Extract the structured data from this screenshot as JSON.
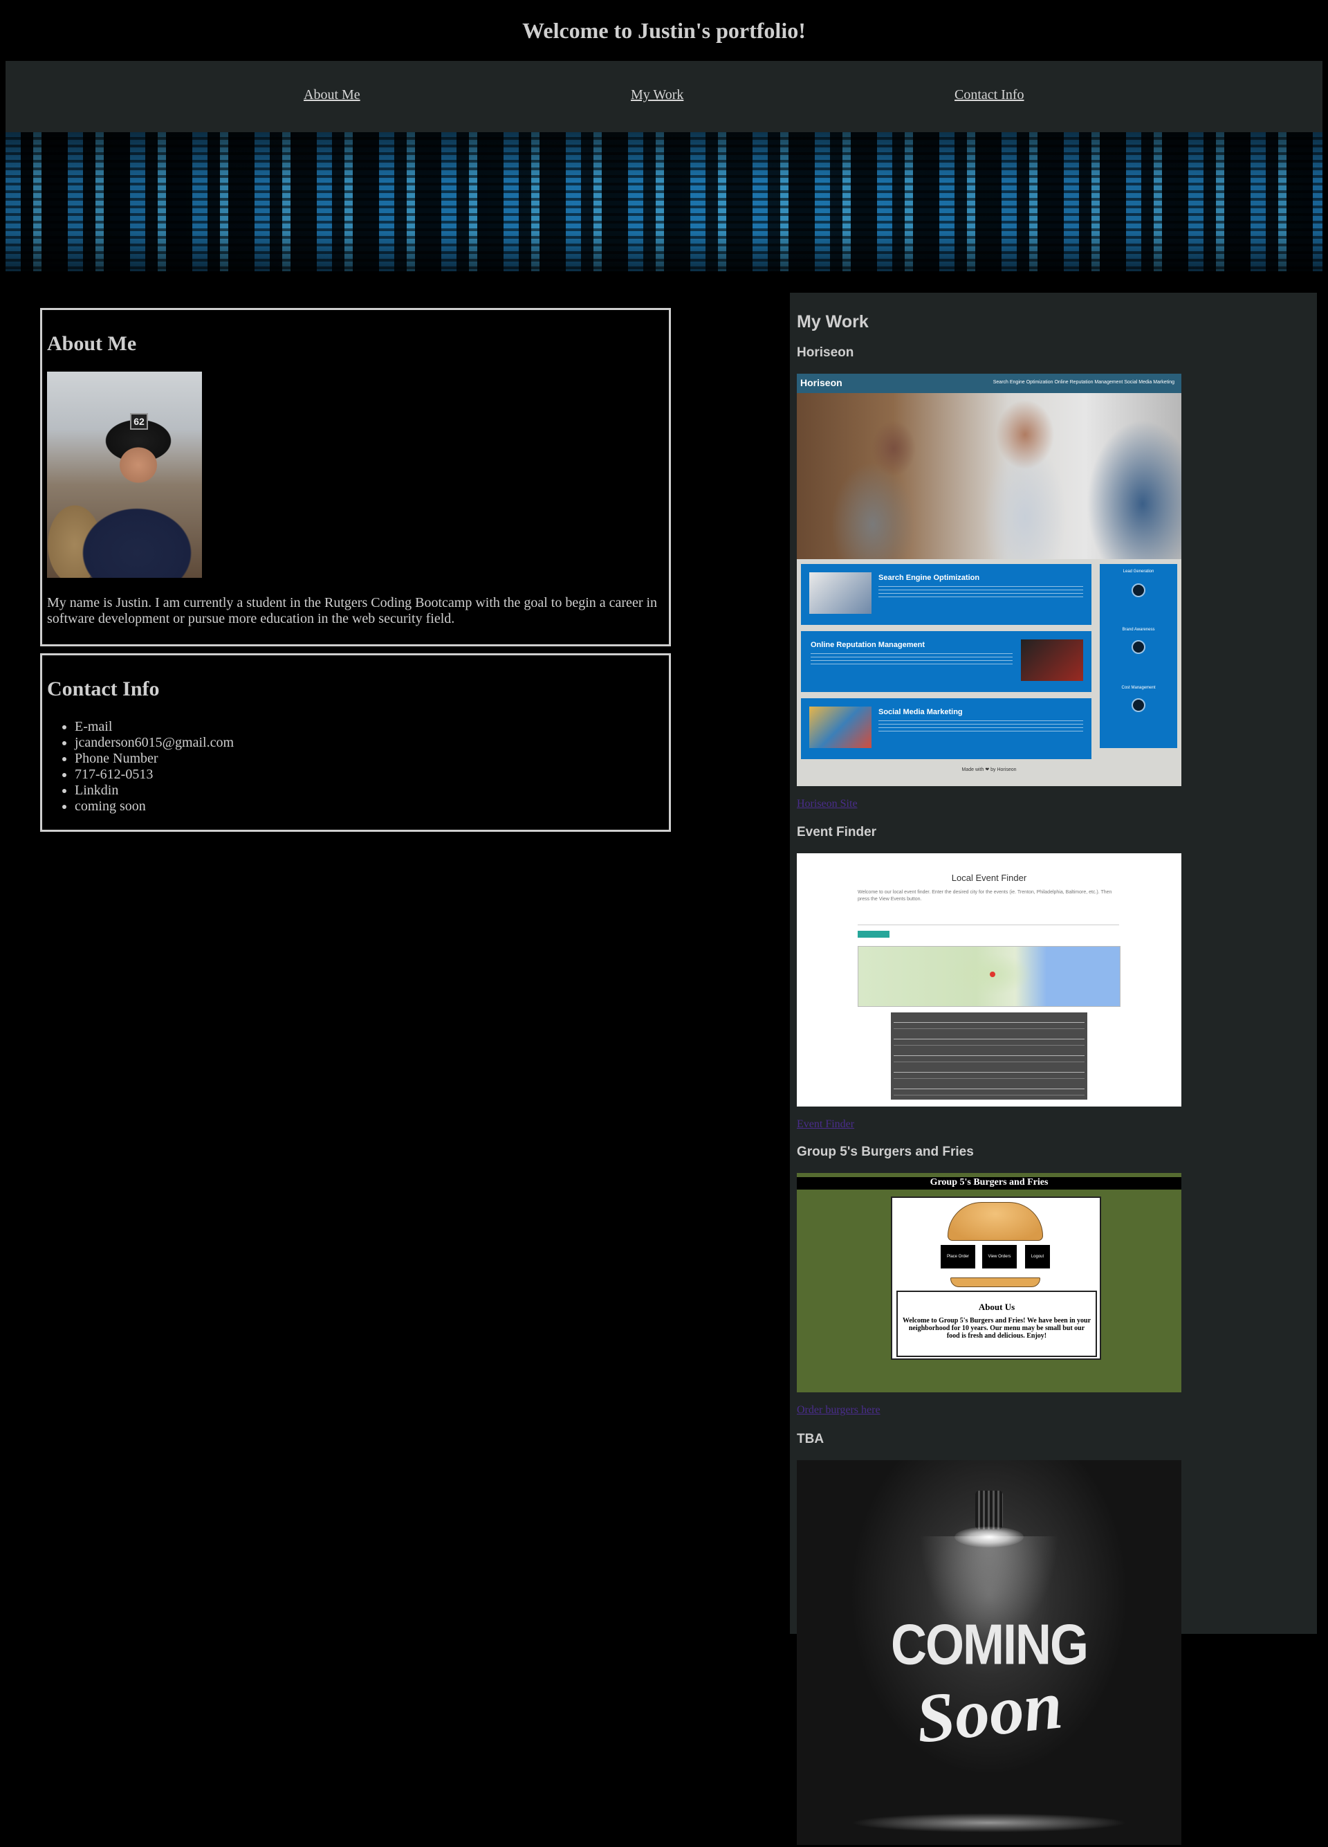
{
  "page": {
    "title": "Welcome to Justin's portfolio!"
  },
  "nav": {
    "items": [
      {
        "label": "About Me"
      },
      {
        "label": "My Work"
      },
      {
        "label": "Contact Info"
      }
    ]
  },
  "about": {
    "heading": "About Me",
    "photo_number": "62",
    "text": "My name is Justin. I am currently a student in the Rutgers Coding Bootcamp with the goal to begin a career in software development or pursue more education in the web security field."
  },
  "contact": {
    "heading": "Contact Info",
    "items": [
      "E-mail",
      "jcanderson6015@gmail.com",
      "Phone Number",
      "717-612-0513",
      "Linkdin",
      "coming soon"
    ]
  },
  "work": {
    "heading": "My Work",
    "projects": [
      {
        "title": "Horiseon",
        "link": "Horiseon Site",
        "mock": {
          "logo": "Horiseon",
          "nav": "Search Engine Optimization    Online Reputation Management    Social Media Marketing",
          "cards": [
            "Search Engine Optimization",
            "Online Reputation Management",
            "Social Media Marketing"
          ],
          "side": [
            "Lead Generation",
            "Brand Awareness",
            "Cost Management"
          ],
          "footer": "Made with ❤ by Horiseon"
        }
      },
      {
        "title": "Event Finder",
        "link": "Event Finder",
        "mock": {
          "title": "Local Event Finder",
          "desc": "Welcome to our local event finder. Enter the desired city for the events (ie. Trenton, Philadelphia, Baltimore, etc.). Then press the View Events button."
        }
      },
      {
        "title": "Group 5's Burgers and Fries",
        "link": "Order burgers here",
        "mock": {
          "header": "Group 5's Burgers and Fries",
          "buttons": [
            "Place Order",
            "View Orders",
            "Logout"
          ],
          "about_title": "About Us",
          "about_text": "Welcome to Group 5's Burgers and Fries! We have been in your neighborhood for 10 years. Our menu may be small but our food is fresh and delicious. Enjoy!"
        }
      },
      {
        "title": "TBA",
        "mock": {
          "line1": "COMING",
          "line2": "Soon"
        }
      }
    ]
  }
}
